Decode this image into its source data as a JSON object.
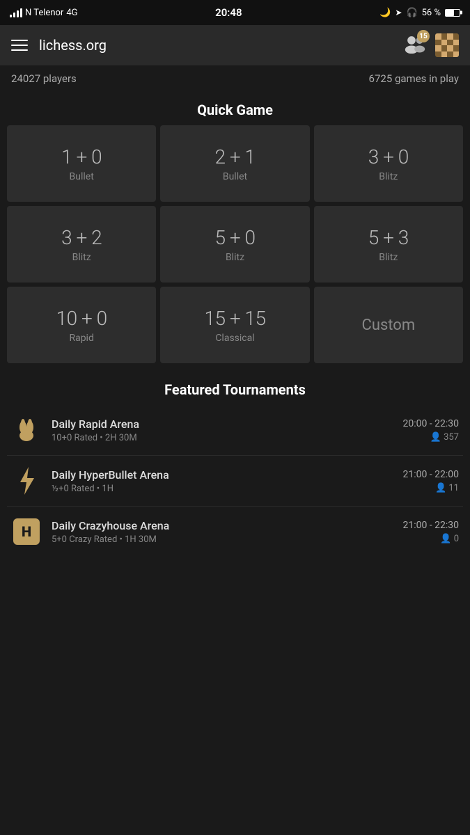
{
  "statusBar": {
    "carrier": "N Telenor",
    "network": "4G",
    "time": "20:48",
    "battery": "56 %",
    "batteryLevel": 56
  },
  "navbar": {
    "title": "lichess.org",
    "friendsBadge": "15"
  },
  "stats": {
    "players": "24027 players",
    "games": "6725 games in play"
  },
  "quickGame": {
    "sectionTitle": "Quick Game",
    "tiles": [
      {
        "time": "1 + 0",
        "type": "Bullet"
      },
      {
        "time": "2 + 1",
        "type": "Bullet"
      },
      {
        "time": "3 + 0",
        "type": "Blitz"
      },
      {
        "time": "3 + 2",
        "type": "Blitz"
      },
      {
        "time": "5 + 0",
        "type": "Blitz"
      },
      {
        "time": "5 + 3",
        "type": "Blitz"
      },
      {
        "time": "10 + 0",
        "type": "Rapid"
      },
      {
        "time": "15 + 15",
        "type": "Classical"
      },
      {
        "time": "Custom",
        "type": ""
      }
    ]
  },
  "tournaments": {
    "sectionTitle": "Featured Tournaments",
    "items": [
      {
        "name": "Daily Rapid Arena",
        "meta": "10+0 Rated • 2H 30M",
        "time": "20:00 - 22:30",
        "players": "357",
        "iconType": "rabbit"
      },
      {
        "name": "Daily HyperBullet Arena",
        "meta": "½+0 Rated • 1H",
        "time": "21:00 - 22:00",
        "players": "11",
        "iconType": "bolt"
      },
      {
        "name": "Daily Crazyhouse Arena",
        "meta": "5+0 Crazy Rated • 1H 30M",
        "time": "21:00 - 22:30",
        "players": "0",
        "iconType": "house"
      }
    ]
  }
}
